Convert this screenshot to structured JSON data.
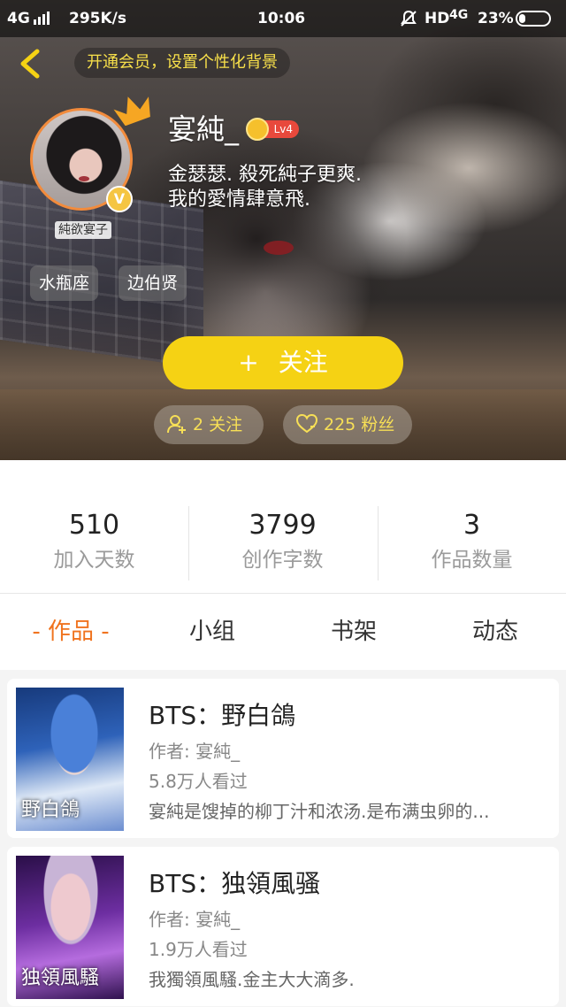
{
  "status_bar": {
    "network": "4G",
    "speed": "295K/s",
    "time": "10:06",
    "hd": "HD",
    "network2": "4G",
    "battery": "23%",
    "battery_level": 0.23
  },
  "header": {
    "vip_banner": "开通会员，设置个性化背景",
    "username": "宴純_",
    "level": "Lv4",
    "bio_line1": "金瑟瑟. 殺死純子更爽.",
    "bio_line2": "我的愛情肆意飛.",
    "avatar_caption": "純欲宴子",
    "verified_mark": "V",
    "tags": [
      "水瓶座",
      "边伯贤"
    ],
    "follow_label": "关注",
    "follow_plus": "+",
    "following_label": "2 关注",
    "fans_label": "225 粉丝"
  },
  "stats": [
    {
      "value": "510",
      "label": "加入天数"
    },
    {
      "value": "3799",
      "label": "创作字数"
    },
    {
      "value": "3",
      "label": "作品数量"
    }
  ],
  "tabs": [
    {
      "label": "- 作品 -",
      "active": true
    },
    {
      "label": "小组",
      "active": false
    },
    {
      "label": "书架",
      "active": false
    },
    {
      "label": "动态",
      "active": false
    }
  ],
  "works": [
    {
      "title": "BTS：野白鴿",
      "author": "作者: 宴純_",
      "views": "5.8万人看过",
      "desc": "宴純是馊掉的柳丁汁和浓汤.是布满虫卵的...",
      "cover_text": "野白鴿"
    },
    {
      "title": "BTS：独領風骚",
      "author": "作者: 宴純_",
      "views": "1.9万人看过",
      "desc": "我獨領風騷.金主大大滴多.",
      "cover_text": "独領風騷"
    }
  ],
  "colors": {
    "accent_yellow": "#f5d214",
    "tab_active": "#f0731e",
    "banner_text": "#f8e04a"
  }
}
